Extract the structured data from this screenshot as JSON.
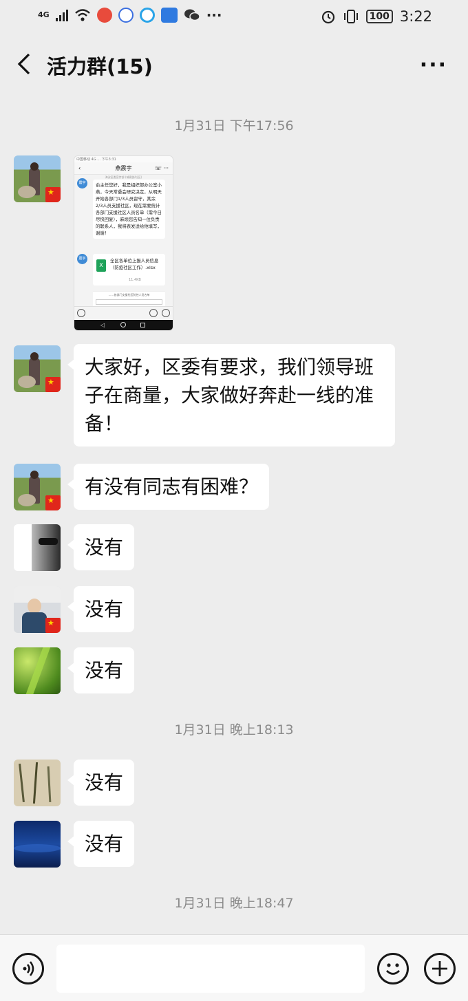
{
  "status_bar": {
    "network": "4G",
    "battery": "100",
    "time": "3:22",
    "app_icons": [
      "notification-icon",
      "baidu-icon",
      "browser-icon",
      "news-icon",
      "wechat-icon"
    ],
    "more": "···"
  },
  "header": {
    "title": "活力群(15)",
    "more": "···"
  },
  "timestamps": [
    "1月31日 下午17:56",
    "1月31日 晚上18:13",
    "1月31日 晚上18:47"
  ],
  "embedded_screenshot": {
    "status": "中国移动 4G   ...   下午3:31",
    "contact": "燕震宇",
    "subtitle": "海淀区委宣传部 (城建部/社区)",
    "sender_label": "震宇",
    "message": "俞主任您好，我是组织部办公室小燕，今天常委会研究决定，从明天开始各部门1/3人员留守，其余2/3人员支援社区，现在需要统计各部门支援社区人员名单（需今日尽快回复），麻烦您告知一位负责的联系人，我将表发送给他填写，谢谢！",
    "file_name": "全区各单位上报人员信息（防疫社区工作）.xlsx",
    "file_size": "11.4KB",
    "table_title": "……各部门支援社区防控人员名单"
  },
  "messages": [
    {
      "sender": "sender-1",
      "text": "大家好，区委有要求，我们领导班子在商量，大家做好奔赴一线的准备！"
    },
    {
      "sender": "sender-1",
      "text": "有没有同志有困难？"
    },
    {
      "sender": "sender-2",
      "text": "没有"
    },
    {
      "sender": "sender-3",
      "text": "没有"
    },
    {
      "sender": "sender-4",
      "text": "没有"
    },
    {
      "sender": "sender-5",
      "text": "没有"
    },
    {
      "sender": "sender-6",
      "text": "没有"
    }
  ],
  "input": {
    "placeholder": ""
  },
  "colors": {
    "background": "#ededed",
    "bubble": "#ffffff",
    "timestamp": "#8a8a8a",
    "flag": "#e0261b"
  }
}
